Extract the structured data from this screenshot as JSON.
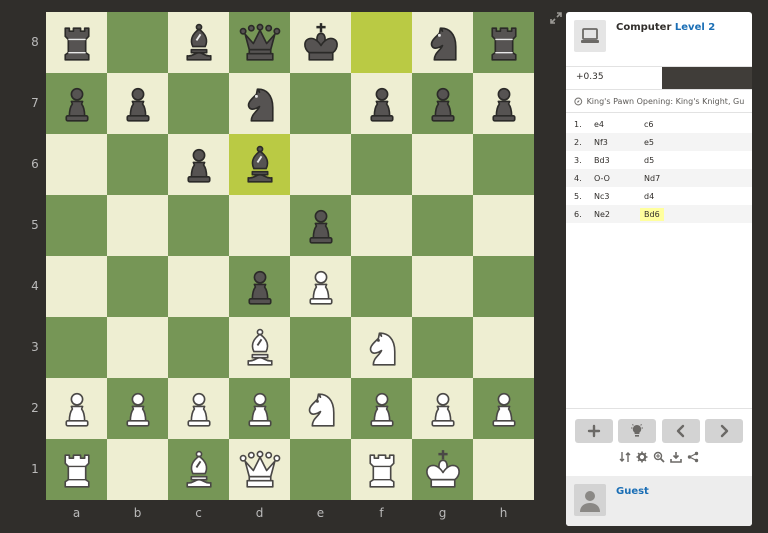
{
  "board": {
    "files": [
      "a",
      "b",
      "c",
      "d",
      "e",
      "f",
      "g",
      "h"
    ],
    "ranks": [
      "8",
      "7",
      "6",
      "5",
      "4",
      "3",
      "2",
      "1"
    ],
    "position": [
      [
        "bR",
        "",
        "bB",
        "bQ",
        "bK",
        "",
        "bN",
        "bR"
      ],
      [
        "bP",
        "bP",
        "",
        "bN",
        "",
        "bP",
        "bP",
        "bP"
      ],
      [
        "",
        "",
        "bP",
        "bB",
        "",
        "",
        "",
        ""
      ],
      [
        "",
        "",
        "",
        "",
        "bP",
        "",
        "",
        ""
      ],
      [
        "",
        "",
        "",
        "bP",
        "wP",
        "",
        "",
        ""
      ],
      [
        "",
        "",
        "",
        "wB",
        "",
        "wN",
        "",
        ""
      ],
      [
        "wP",
        "wP",
        "wP",
        "wP",
        "wN",
        "wP",
        "wP",
        "wP"
      ],
      [
        "wR",
        "",
        "wB",
        "wQ",
        "",
        "wR",
        "wK",
        ""
      ]
    ],
    "highlighted_squares": [
      "f8",
      "d6"
    ],
    "colors": {
      "light": "#eeeed2",
      "dark": "#769656",
      "highlight": "#baca44"
    }
  },
  "panel": {
    "opponent": {
      "name": "Computer",
      "level": "Level 2",
      "icon": "computer-icon"
    },
    "evaluation": "+0.35",
    "opening": "King's Pawn Opening: King's Knight, Gu...",
    "moves": [
      {
        "num": "1.",
        "white": "e4",
        "black": "c6"
      },
      {
        "num": "2.",
        "white": "Nf3",
        "black": "e5"
      },
      {
        "num": "3.",
        "white": "Bd3",
        "black": "d5"
      },
      {
        "num": "4.",
        "white": "O-O",
        "black": "Nd7"
      },
      {
        "num": "5.",
        "white": "Nc3",
        "black": "d4"
      },
      {
        "num": "6.",
        "white": "Ne2",
        "black": "Bd6"
      }
    ],
    "current_move": "6b",
    "buttons": [
      "plus-icon",
      "lightbulb-icon",
      "chevron-left-icon",
      "chevron-right-icon"
    ],
    "tools": [
      "flip-board-icon",
      "gear-icon",
      "analysis-icon",
      "download-icon",
      "share-icon"
    ],
    "player": {
      "name": "Guest",
      "icon": "user-icon"
    }
  }
}
